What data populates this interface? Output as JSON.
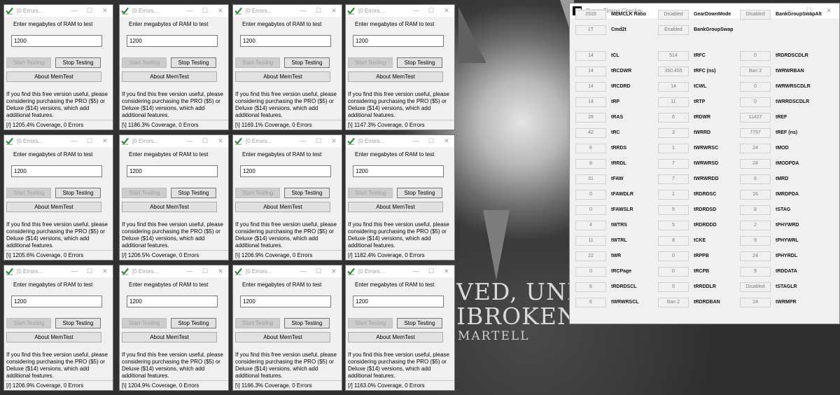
{
  "memtest": {
    "title": "[0 Errors...",
    "prompt": "Enter megabytes of RAM to test",
    "start_label": "Start Testing",
    "stop_label": "Stop Testing",
    "about_label": "About MemTest",
    "info": "If you find this free version useful, please considering purchasing the PRO ($5) or Deluxe ($14) versions, which add additional features.",
    "minimize_glyph": "—",
    "maximize_glyph": "☐",
    "close_glyph": "✕",
    "windows": [
      {
        "value": "1200",
        "status": "[/]   1205.4% Coverage, 0 Errors"
      },
      {
        "value": "1200",
        "status": "[\\]   1186.3% Coverage, 0 Errors"
      },
      {
        "value": "1200",
        "status": "[\\]   1169.1% Coverage, 0 Errors"
      },
      {
        "value": "1200",
        "status": "[\\]   1147.3% Coverage, 0 Errors"
      },
      {
        "value": "1200",
        "status": "[\\]   1205.6% Coverage, 0 Errors"
      },
      {
        "value": "1200",
        "status": "[/]   1206.5% Coverage, 0 Errors"
      },
      {
        "value": "1200",
        "status": "[\\]   1206.9% Coverage, 0 Errors"
      },
      {
        "value": "1200",
        "status": "[/]   1182.4% Coverage, 0 Errors"
      },
      {
        "value": "1200",
        "status": "[/]   1206.9% Coverage, 0 Errors"
      },
      {
        "value": "1200",
        "status": "[\\]   1204.9% Coverage, 0 Errors"
      },
      {
        "value": "1200",
        "status": "[\\]   1166.3% Coverage, 0 Errors"
      },
      {
        "value": "1200",
        "status": "[/]   1163.0% Coverage, 0 Errors"
      }
    ]
  },
  "rtc": {
    "title": "Ryzen Timing Checker",
    "top_rows": [
      [
        {
          "value": "2933",
          "label": "MEMCLK Ratio"
        },
        {
          "value": "Disabled",
          "label": "GearDownMode"
        },
        {
          "value": "Disabled",
          "label": "BankGroupSwapAlt"
        }
      ],
      [
        {
          "value": "1T",
          "label": "Cmd2t"
        },
        {
          "value": "Enabled",
          "label": "BankGroupSwap"
        },
        null
      ]
    ],
    "rows": [
      [
        {
          "value": "14",
          "label": "tCL"
        },
        {
          "value": "514",
          "label": "tRFC"
        },
        {
          "value": "0",
          "label": "tRDRDSCDLR"
        }
      ],
      [
        {
          "value": "14",
          "label": "tRCDWR"
        },
        {
          "value": "350.455",
          "label": "tRFC (ns)"
        },
        {
          "value": "Ban 2",
          "label": "tWRWRBAN"
        }
      ],
      [
        {
          "value": "14",
          "label": "tRCDRD"
        },
        {
          "value": "14",
          "label": "tCWL"
        },
        {
          "value": "0",
          "label": "tWRWRSCDLR"
        }
      ],
      [
        {
          "value": "14",
          "label": "tRP"
        },
        {
          "value": "11",
          "label": "tRTP"
        },
        {
          "value": "0",
          "label": "tWRRDSCDLR"
        }
      ],
      [
        {
          "value": "28",
          "label": "tRAS"
        },
        {
          "value": "6",
          "label": "tRDWR"
        },
        {
          "value": "11437",
          "label": "tREF"
        }
      ],
      [
        {
          "value": "42",
          "label": "tRC"
        },
        {
          "value": "3",
          "label": "tWRRD"
        },
        {
          "value": "7797",
          "label": "tREF (ns)"
        }
      ],
      [
        {
          "value": "6",
          "label": "tRRDS"
        },
        {
          "value": "1",
          "label": "tWRWRSC"
        },
        {
          "value": "24",
          "label": "tMOD"
        }
      ],
      [
        {
          "value": "8",
          "label": "tRRDL"
        },
        {
          "value": "7",
          "label": "tWRWRSD"
        },
        {
          "value": "24",
          "label": "tMODPDA"
        }
      ],
      [
        {
          "value": "31",
          "label": "tFAW"
        },
        {
          "value": "7",
          "label": "tWRWRDD"
        },
        {
          "value": "8",
          "label": "tMRD"
        }
      ],
      [
        {
          "value": "0",
          "label": "tFAWDLR"
        },
        {
          "value": "1",
          "label": "tRDRDSC"
        },
        {
          "value": "16",
          "label": "tMRDPDA"
        }
      ],
      [
        {
          "value": "0",
          "label": "tFAWSLR"
        },
        {
          "value": "5",
          "label": "tRDRDSD"
        },
        {
          "value": "8",
          "label": "tSTAG"
        }
      ],
      [
        {
          "value": "4",
          "label": "tWTRS"
        },
        {
          "value": "5",
          "label": "tRDRDDD"
        },
        {
          "value": "2",
          "label": "tPHYWRD"
        }
      ],
      [
        {
          "value": "11",
          "label": "tWTRL"
        },
        {
          "value": "8",
          "label": "tCKE"
        },
        {
          "value": "9",
          "label": "tPHYWRL"
        }
      ],
      [
        {
          "value": "22",
          "label": "tWR"
        },
        {
          "value": "0",
          "label": "tRPPB"
        },
        {
          "value": "24",
          "label": "tPHYRDL"
        }
      ],
      [
        {
          "value": "0",
          "label": "tRCPage"
        },
        {
          "value": "0",
          "label": "tRCPB"
        },
        {
          "value": "9",
          "label": "tRDDATA"
        }
      ],
      [
        {
          "value": "6",
          "label": "tRDRDSCL"
        },
        {
          "value": "0",
          "label": "tRRDDLR"
        },
        {
          "value": "Disabled",
          "label": "tSTAGLR"
        }
      ],
      [
        {
          "value": "6",
          "label": "tWRWRSCL"
        },
        {
          "value": "Ban 2",
          "label": "tRDRDBAN"
        },
        {
          "value": "24",
          "label": "tWRMPR"
        }
      ]
    ]
  },
  "wallpaper": {
    "motto_line1": "VED, UNBEN",
    "motto_line2": "IBROKEN",
    "motto_line3": "MARTELL"
  },
  "colors": {
    "button_face": "#e1e1e1",
    "window_bg": "#f0f0f0",
    "memtest_icon_green": "#2e8b3d"
  },
  "icons": {
    "memtest": "memtest-check-icon",
    "rtc": "ryzen-logo-icon"
  }
}
